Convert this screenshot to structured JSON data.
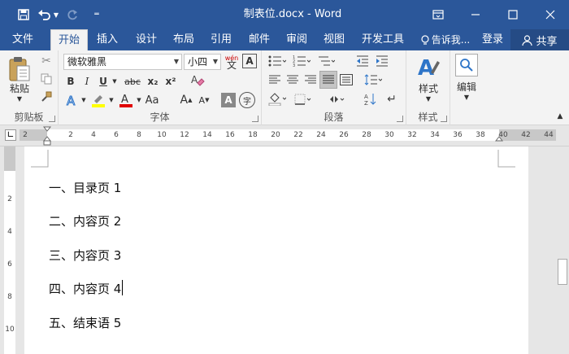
{
  "window": {
    "title": "制表位.docx - Word",
    "qat": {
      "save_icon": "floppy-disk-icon",
      "undo_icon": "undo-icon",
      "redo_icon": "redo-icon",
      "customize_icon": "customize-icon"
    },
    "controls": {
      "ribbon_display_icon": "ribbon-display-icon",
      "minimize_icon": "minimize-icon",
      "maximize_icon": "maximize-icon",
      "close_icon": "close-icon"
    }
  },
  "tabs": [
    {
      "label": "文件"
    },
    {
      "label": "开始"
    },
    {
      "label": "插入"
    },
    {
      "label": "设计"
    },
    {
      "label": "布局"
    },
    {
      "label": "引用"
    },
    {
      "label": "邮件"
    },
    {
      "label": "审阅"
    },
    {
      "label": "视图"
    },
    {
      "label": "开发工具"
    }
  ],
  "tellme": "告诉我...",
  "signin": "登录",
  "share": "共享",
  "ribbon": {
    "clipboard": {
      "label": "剪贴板",
      "paste": "粘贴"
    },
    "font": {
      "label": "字体",
      "font_name": "微软雅黑",
      "font_size": "小四",
      "wen": "wén",
      "bold": "B",
      "italic": "I",
      "underline": "U",
      "strike": "abc",
      "subscript": "x₂",
      "superscript": "x²",
      "grow": "A",
      "shrink": "A",
      "char_shade": "A",
      "enclose": "字",
      "char_border": "A"
    },
    "paragraph": {
      "label": "段落"
    },
    "styles": {
      "label": "样式",
      "button": "样式"
    },
    "editing": {
      "button": "编辑"
    }
  },
  "ruler": {
    "ticks": [
      "2",
      "2",
      "4",
      "6",
      "8",
      "10",
      "12",
      "14",
      "16",
      "18",
      "20",
      "22",
      "24",
      "26",
      "28",
      "30",
      "32",
      "34",
      "36",
      "38",
      "40",
      "42",
      "44"
    ],
    "vticks": [
      "2",
      "4",
      "6",
      "8",
      "10"
    ]
  },
  "document": {
    "lines": [
      "一、目录页 1",
      "二、内容页 2",
      "三、内容页 3",
      "四、内容页 4",
      "五、结束语 5"
    ]
  }
}
